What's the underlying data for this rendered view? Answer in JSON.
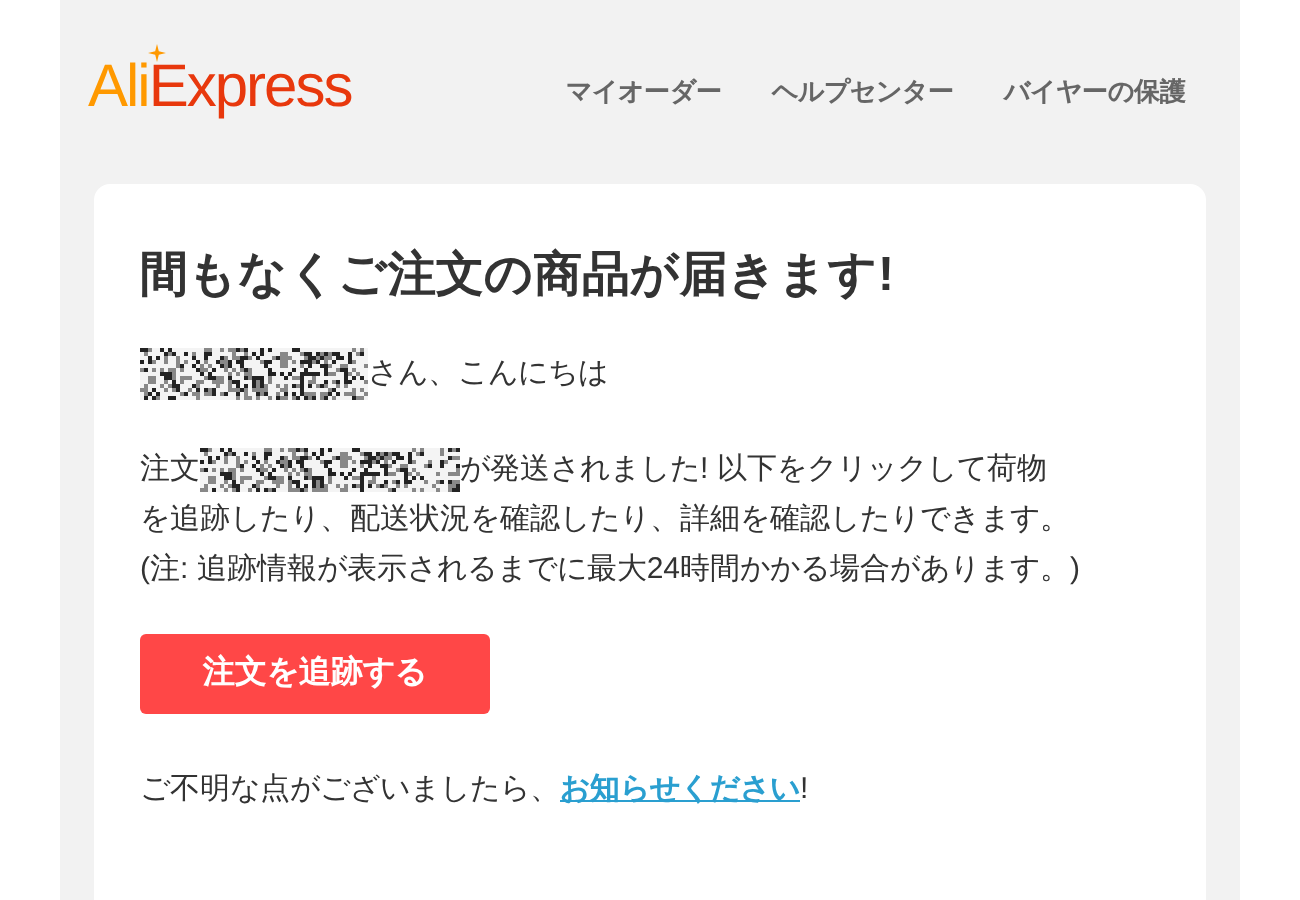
{
  "header": {
    "logo": [
      "Ali",
      "Express"
    ],
    "nav": [
      "マイオーダー",
      "ヘルプセンター",
      "バイヤーの保護"
    ]
  },
  "card": {
    "title": "間もなくご注文の商品が届きます!",
    "greeting": "さん、こんにちは",
    "order_prefix": "注文",
    "order_text": [
      "が発送されました! 以下をクリックして荷物",
      "を追跡したり、配送状況を確認したり、詳細を確認したりできます。"
    ],
    "note": "(注: 追跡情報が表示されるまでに最大24時間かかる場合があります。)",
    "button": "注文を追跡する",
    "contact_text": "ご不明な点がございましたら、",
    "contact_link": "お知らせください",
    "contact_end": "!"
  }
}
